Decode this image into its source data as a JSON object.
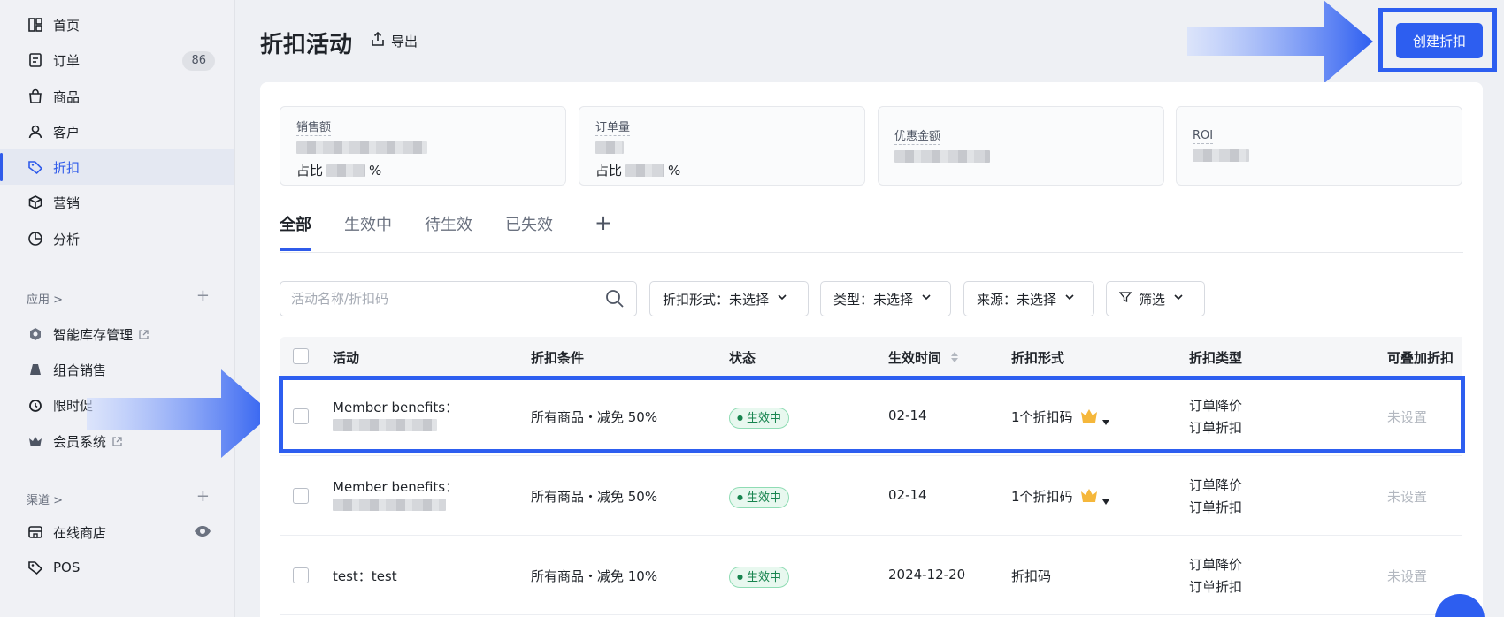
{
  "sidebar": {
    "nav": [
      {
        "label": "首页",
        "icon": "dashboard-icon"
      },
      {
        "label": "订单",
        "icon": "order-icon",
        "badge": "86"
      },
      {
        "label": "商品",
        "icon": "bag-icon"
      },
      {
        "label": "客户",
        "icon": "user-icon"
      },
      {
        "label": "折扣",
        "icon": "tag-icon",
        "active": true
      },
      {
        "label": "营销",
        "icon": "cube-icon"
      },
      {
        "label": "分析",
        "icon": "pie-icon"
      }
    ],
    "apps_title": "应用 >",
    "apps": [
      {
        "label": "智能库存管理",
        "icon": "inventory-icon"
      },
      {
        "label": "组合销售",
        "icon": "bundle-icon"
      },
      {
        "label": "限时促",
        "icon": "clock-icon"
      },
      {
        "label": "会员系统",
        "icon": "crown-icon"
      }
    ],
    "channels_title": "渠道 >",
    "channels": [
      {
        "label": "在线商店",
        "icon": "store-icon"
      },
      {
        "label": "POS",
        "icon": "pos-icon"
      }
    ]
  },
  "header": {
    "title": "折扣活动",
    "export_label": "导出",
    "create_label": "创建折扣"
  },
  "stats": [
    {
      "label": "销售额",
      "ratio_prefix": "占比",
      "ratio_suffix": "%"
    },
    {
      "label": "订单量",
      "ratio_prefix": "占比",
      "ratio_suffix": "%"
    },
    {
      "label": "优惠金额"
    },
    {
      "label": "ROI"
    }
  ],
  "tabs": [
    "全部",
    "生效中",
    "待生效",
    "已失效"
  ],
  "search": {
    "placeholder": "活动名称/折扣码"
  },
  "filters": [
    {
      "label": "折扣形式：未选择"
    },
    {
      "label": "类型：未选择"
    },
    {
      "label": "来源：未选择"
    },
    {
      "label": "筛选"
    }
  ],
  "table": {
    "columns": [
      "活动",
      "折扣条件",
      "状态",
      "生效时间",
      "折扣形式",
      "折扣类型",
      "可叠加折扣"
    ],
    "rows": [
      {
        "name": "Member benefits：",
        "condition": "所有商品・减免 50%",
        "status": "生效中",
        "time": "02-14",
        "form": "1个折扣码",
        "type1": "订单降价",
        "type2": "订单折扣",
        "stack": "未设置"
      },
      {
        "name": "Member benefits：",
        "condition": "所有商品・减免 50%",
        "status": "生效中",
        "time": "02-14",
        "form": "1个折扣码",
        "type1": "订单降价",
        "type2": "订单折扣",
        "stack": "未设置"
      },
      {
        "name": "test：test",
        "condition": "所有商品・减免 10%",
        "status": "生效中",
        "time": "2024-12-20",
        "form": "折扣码",
        "type1": "订单降价",
        "type2": "订单折扣",
        "stack": "未设置"
      }
    ]
  },
  "colors": {
    "accent": "#2d5ef0",
    "status_green": "#17844e"
  }
}
